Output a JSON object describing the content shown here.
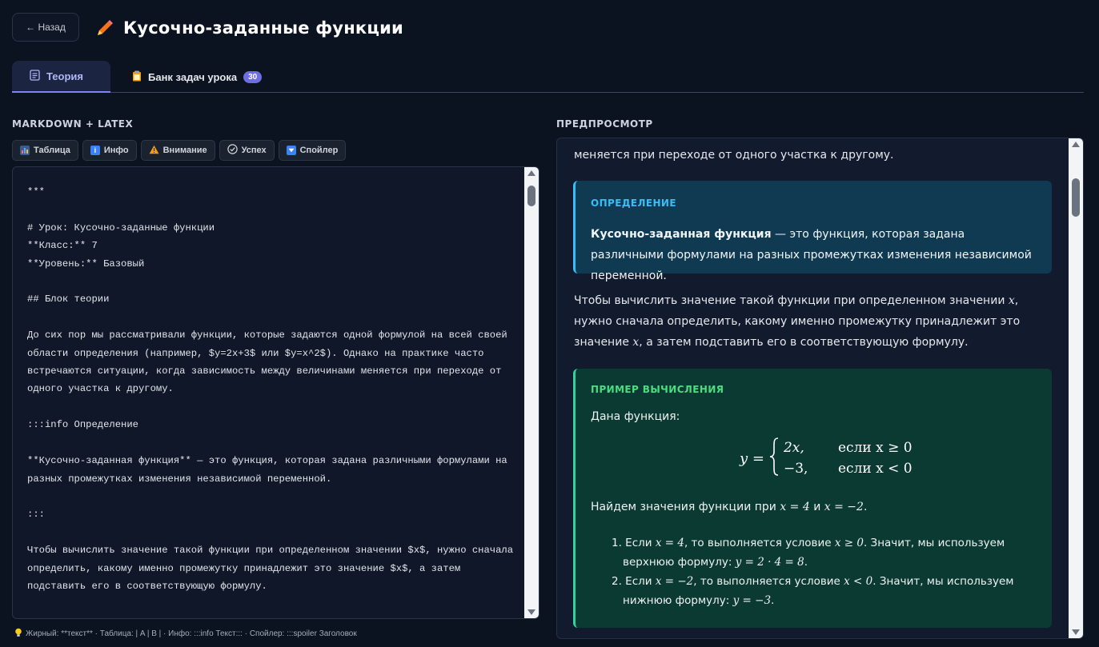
{
  "header": {
    "back_label": "← Назад",
    "title": "Кусочно-заданные функции",
    "title_icon": "pencil-icon"
  },
  "tabs": [
    {
      "label": "Теория",
      "icon": "document-icon",
      "active": true
    },
    {
      "label": "Банк задач урока",
      "icon": "clipboard-icon",
      "badge": "30",
      "active": false
    }
  ],
  "editor_section": {
    "label": "MARKDOWN + LATEX",
    "toolbar": [
      {
        "label": "Таблица",
        "icon": "chart-icon"
      },
      {
        "label": "Инфо",
        "icon": "info-icon"
      },
      {
        "label": "Внимание",
        "icon": "warning-icon"
      },
      {
        "label": "Успех",
        "icon": "check-circle-icon"
      },
      {
        "label": "Спойлер",
        "icon": "chevron-down-square-icon"
      }
    ],
    "content": "***\n\n# Урок: Кусочно-заданные функции\n**Класс:** 7\n**Уровень:** Базовый\n\n## Блок теории\n\nДо сих пор мы рассматривали функции, которые задаются одной формулой на всей своей области определения (например, $y=2x+3$ или $y=x^2$). Однако на практике часто встречаются ситуации, когда зависимость между величинами меняется при переходе от одного участка к другому.\n\n:::info Определение\n\n**Кусочно-заданная функция** — это функция, которая задана различными формулами на разных промежутках изменения независимой переменной.\n\n:::\n\nЧтобы вычислить значение такой функции при определенном значении $x$, нужно сначала определить, какому именно промежутку принадлежит это значение $x$, а затем подставить его в соответствующую формулу.\n\n:::success Пример вычисления",
    "hint": "Жирный: **текст** · Таблица: | A | B | · Инфо: :::info Текст::: · Спойлер: :::spoiler Заголовок"
  },
  "preview_section": {
    "label": "ПРЕДПРОСМОТР",
    "intro_line": "меняется при переходе от одного участка к другому.",
    "info_box": {
      "title": "ОПРЕДЕЛЕНИЕ",
      "term": "Кусочно-заданная функция",
      "body": " — это функция, которая задана различными формулами на разных промежутках изменения независимой переменной."
    },
    "paragraph": {
      "p1": "Чтобы вычислить значение такой функции при определенном значении ",
      "var_x": "x",
      "p2": ",",
      "p3": "нужно сначала определить, какому именно промежутку принадлежит это",
      "p4": "значение ",
      "p5": ", а затем подставить его в соответствующую формулу."
    },
    "success_box": {
      "title": "ПРИМЕР ВЫЧИСЛЕНИЯ",
      "given": "Дана функция:",
      "lhs": "y =",
      "case1_expr": "2x,",
      "case1_cond": "если x ≥ 0",
      "case2_expr": "−3,",
      "case2_cond": "если x < 0",
      "find_prefix": "Найдем значения функции при ",
      "find_x1": "x = 4",
      "find_and": " и ",
      "find_x2": "x = −2",
      "find_suffix": ".",
      "step1_num": "1.",
      "step1_a": " Если ",
      "step1_x": "x = 4",
      "step1_b": ", то выполняется условие ",
      "step1_cond": "x ≥ 0",
      "step1_c": ". Значит, мы используем",
      "step1_d": "верхнюю формулу: ",
      "step1_formula": "y = 2 · 4 = 8",
      "step1_e": ".",
      "step2_num": "2.",
      "step2_a": " Если ",
      "step2_x": "x = −2",
      "step2_b": ", то выполняется условие ",
      "step2_cond": "x < 0",
      "step2_c": ". Значит, мы используем",
      "step2_d": "нижнюю формулу: ",
      "step2_formula": "y = −3",
      "step2_e": "."
    }
  },
  "colors": {
    "background": "#0b1220",
    "accent": "#7b86f2",
    "info": "#38bdf8",
    "success": "#4ade80",
    "badge": "#6d6fe0"
  }
}
